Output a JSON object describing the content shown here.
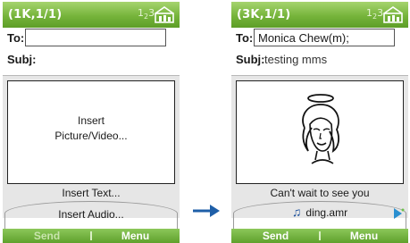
{
  "left_screen": {
    "title": "(1K,1/1)",
    "input_mode": "123",
    "to_label": "To:",
    "to_value": "",
    "subj_label": "Subj:",
    "subj_value": "",
    "media_placeholder_line1": "Insert",
    "media_placeholder_line2": "Picture/Video...",
    "insert_text": "Insert Text...",
    "insert_audio": "Insert Audio...",
    "softkey_left": "Send",
    "softkey_right": "Menu"
  },
  "right_screen": {
    "title": "(3K,1/1)",
    "input_mode": "123",
    "to_label": "To:",
    "to_value": "Monica Chew(m);",
    "subj_label": "Subj:",
    "subj_value": "testing mms",
    "message_text": "Can't wait to see you",
    "audio_file": "ding.amr",
    "softkey_left": "Send",
    "softkey_right": "Menu"
  },
  "colors": {
    "titlebar": "#76b43b",
    "softbar": "#5fa12c",
    "arrow": "#1f5fa8"
  },
  "icons": [
    "signal-icon",
    "music-note-icon",
    "next-slide-icon",
    "arrow-right-icon"
  ]
}
